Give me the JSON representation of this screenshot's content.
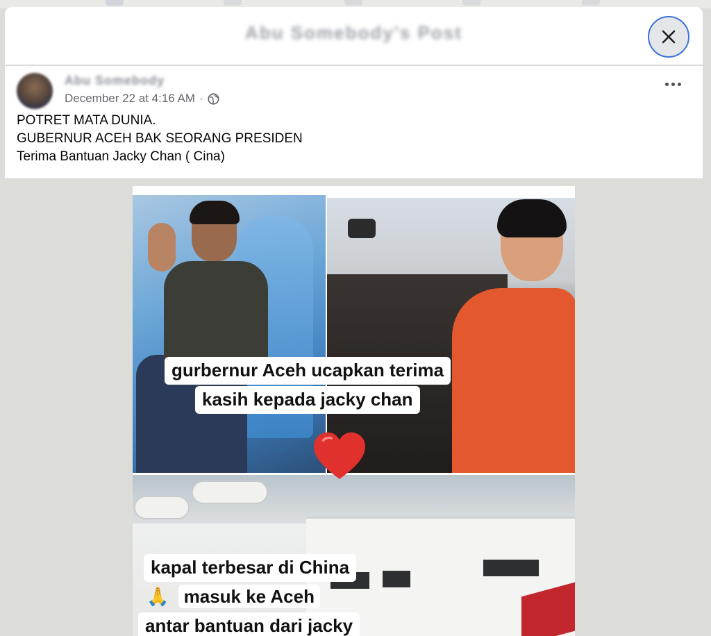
{
  "modal": {
    "title": "Abu Somebody's Post",
    "close_label": "×"
  },
  "post": {
    "author": "Abu Somebody",
    "timestamp": "December 22 at 4:16 AM",
    "separator": "·",
    "privacy_icon": "globe-icon",
    "lines": [
      "POTRET MATA DUNIA.",
      "GUBERNUR ACEH BAK SEORANG PRESIDEN",
      "Terima Bantuan Jacky Chan ( Cina)"
    ]
  },
  "image": {
    "caption1_line1": "gurbernur Aceh ucapkan terima",
    "caption1_line2": "kasih kepada jacky chan",
    "caption2_line1": "kapal terbesar di China",
    "caption2_line2": "masuk ke Aceh",
    "caption2_line3": "antar bantuan dari jacky",
    "emoji_heart": "heart-icon",
    "emoji_pray": "🙏"
  },
  "colors": {
    "accent": "#3b73d9",
    "backdrop": "#dcddd8",
    "heart": "#e0312d",
    "jacket": "#e3582e"
  }
}
